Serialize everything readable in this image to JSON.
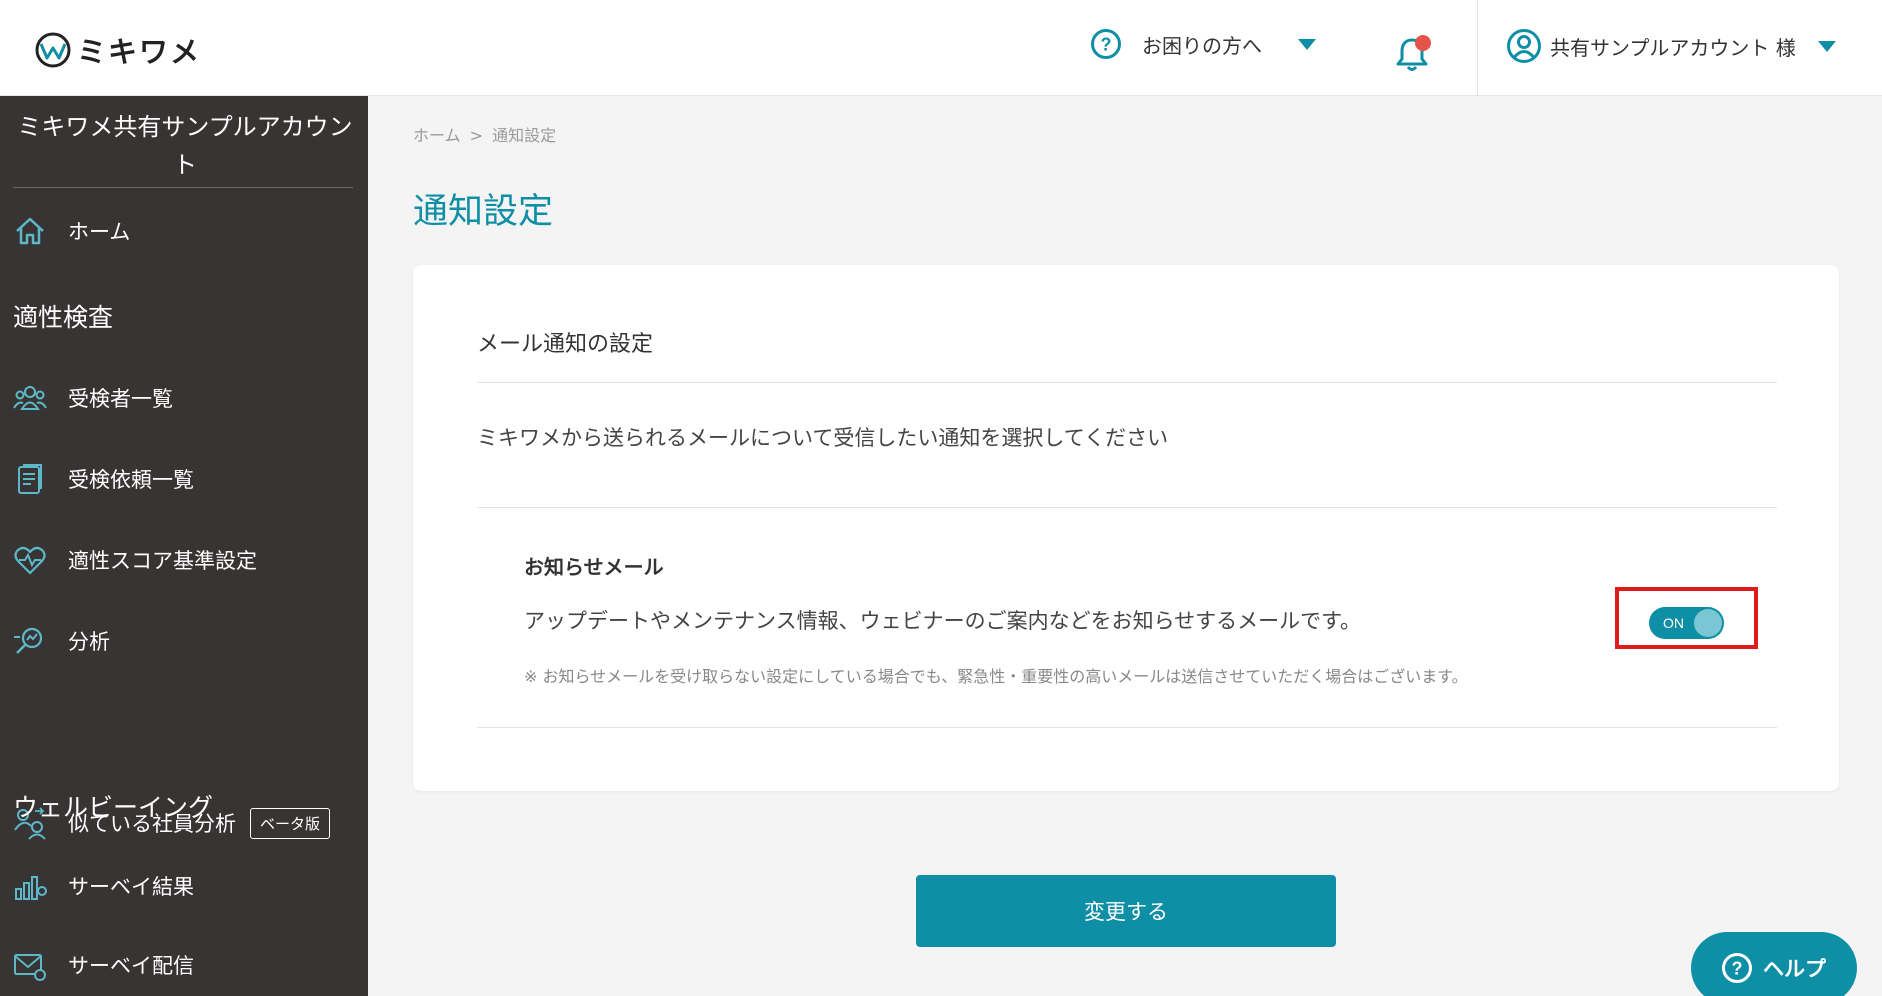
{
  "header": {
    "logo_text": "ミキワメ",
    "help_menu_label": "お困りの方へ",
    "account_name": "共有サンプルアカウント 様"
  },
  "sidebar": {
    "org_name": "ミキワメ共有サンプルアカウント",
    "home_label": "ホーム",
    "section_aptitude": "適性検査",
    "items_aptitude": [
      {
        "label": "受検者一覧",
        "icon": "users-icon"
      },
      {
        "label": "受検依頼一覧",
        "icon": "document-icon"
      },
      {
        "label": "適性スコア基準設定",
        "icon": "heart-pulse-icon"
      },
      {
        "label": "分析",
        "icon": "magnifier-chart-icon"
      },
      {
        "label": "似ている社員分析",
        "icon": "people-compare-icon",
        "badge": "ベータ版"
      }
    ],
    "section_wellbeing": "ウェルビーイング",
    "items_wellbeing": [
      {
        "label": "サーベイ結果",
        "icon": "survey-chart-icon"
      },
      {
        "label": "サーベイ配信",
        "icon": "mail-icon"
      }
    ]
  },
  "breadcrumb": {
    "home": "ホーム",
    "separator": ">",
    "current": "通知設定"
  },
  "page_title": "通知設定",
  "card": {
    "section_title": "メール通知の設定",
    "description": "ミキワメから送られるメールについて受信したい通知を選択してください",
    "option": {
      "title": "お知らせメール",
      "description": "アップデートやメンテナンス情報、ウェビナーのご案内などをお知らせするメールです。",
      "note": "※ お知らせメールを受け取らない設定にしている場合でも、緊急性・重要性の高いメールは送信させていただく場合はございます。",
      "toggle_label": "ON",
      "toggle_state": true
    }
  },
  "submit_label": "変更する",
  "help_fab_label": "ヘルプ",
  "colors": {
    "accent": "#0f8fa6",
    "sidebar_bg": "#383433",
    "highlight_box": "#e01b1b",
    "notification_dot": "#e5534b"
  }
}
